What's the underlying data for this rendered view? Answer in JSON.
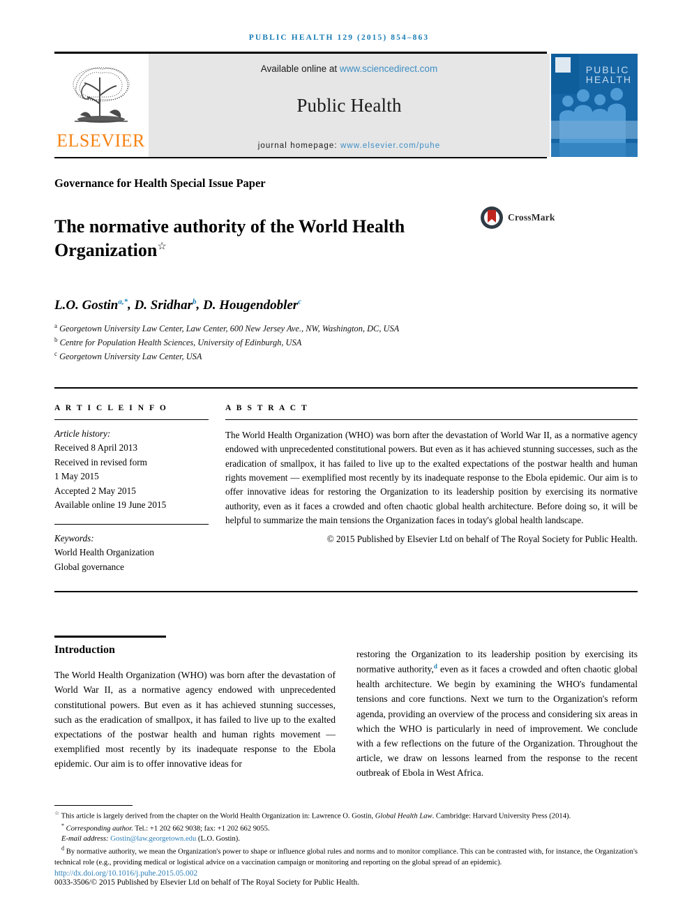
{
  "running_head": "PUBLIC HEALTH 129 (2015) 854–863",
  "masthead": {
    "publisher_logo_name": "ELSEVIER",
    "available_prefix": "Available online at ",
    "available_link": "www.sciencedirect.com",
    "journal_title": "Public Health",
    "homepage_prefix": "journal homepage: ",
    "homepage_link": "www.elsevier.com/puhe",
    "cover_title_line1": "PUBLIC",
    "cover_title_line2": "HEALTH",
    "link_color": "#3d8ec4",
    "elsevier_orange": "#f68212",
    "cover_blue": "#1565a5"
  },
  "article": {
    "section_label": "Governance for Health Special Issue Paper",
    "title": "The normative authority of the World Health Organization",
    "title_footnote_marker": "☆",
    "crossmark_label": "CrossMark",
    "authors": "L.O. Gostin ",
    "authors_parts": [
      {
        "name": "L.O. Gostin",
        "marks": "a,*"
      },
      {
        "name": "D. Sridhar",
        "marks": "b"
      },
      {
        "name": "D. Hougendobler",
        "marks": "c"
      }
    ],
    "affiliations": [
      {
        "mark": "a",
        "text": "Georgetown University Law Center, Law Center, 600 New Jersey Ave., NW, Washington, DC, USA"
      },
      {
        "mark": "b",
        "text": "Centre for Population Health Sciences, University of Edinburgh, USA"
      },
      {
        "mark": "c",
        "text": "Georgetown University Law Center, USA"
      }
    ]
  },
  "info": {
    "heading": "A R T I C L E   I N F O",
    "history_label": "Article history:",
    "history": [
      "Received 8 April 2013",
      "Received in revised form",
      "1 May 2015",
      "Accepted 2 May 2015",
      "Available online 19 June 2015"
    ],
    "keywords_label": "Keywords:",
    "keywords": [
      "World Health Organization",
      "Global governance"
    ]
  },
  "abstract": {
    "heading": "A B S T R A C T",
    "text": "The World Health Organization (WHO) was born after the devastation of World War II, as a normative agency endowed with unprecedented constitutional powers. But even as it has achieved stunning successes, such as the eradication of smallpox, it has failed to live up to the exalted expectations of the postwar health and human rights movement — exemplified most recently by its inadequate response to the Ebola epidemic. Our aim is to offer innovative ideas for restoring the Organization to its leadership position by exercising its normative authority, even as it faces a crowded and often chaotic global health architecture. Before doing so, it will be helpful to summarize the main tensions the Organization faces in today's global health landscape.",
    "copyright": "© 2015  Published by Elsevier Ltd on behalf of The Royal Society for Public Health."
  },
  "body": {
    "heading": "Introduction",
    "left_paragraph": "The World Health Organization (WHO) was born after the devastation of World War II, as a normative agency endowed with unprecedented constitutional powers. But even as it has achieved stunning successes, such as the eradication of smallpox, it has failed to live up to the exalted expectations of the postwar health and human rights movement — exemplified most recently by its inadequate response to the Ebola epidemic. Our aim is to offer innovative ideas for",
    "right_paragraph_1": "restoring the Organization to its leadership position by exercising its normative authority,",
    "right_footnote_marker": "d",
    "right_paragraph_2": " even as it faces a crowded and often chaotic global health architecture. We begin by examining the WHO's fundamental tensions and core functions. Next we turn to the Organization's reform agenda, providing an overview of the process and considering six areas in which the WHO is particularly in need of improvement. We conclude with a few reflections on the future of the Organization. Throughout the article, we draw on lessons learned from the response to the recent outbreak of Ebola in West Africa."
  },
  "footnotes": {
    "star_marker": "☆",
    "star_text_pre": " This article is largely derived from the chapter on the World Health Organization in: Lawrence O. Gostin, ",
    "star_text_italic": "Global Health Law",
    "star_text_post": ". Cambridge: Harvard University Press (2014).",
    "corr_marker": "*",
    "corr_label": "Corresponding author.",
    "corr_text": " Tel.: +1 202 662 9038; fax: +1 202 662 9055.",
    "email_label": "E-mail address: ",
    "email": "Gostin@law.georgetown.edu",
    "email_owner": " (L.O. Gostin).",
    "d_marker": "d",
    "d_text": " By normative authority, we mean the Organization's power to shape or influence global rules and norms and to monitor compliance. This can be contrasted with, for instance, the Organization's technical role (e.g., providing medical or logistical advice on a vaccination campaign or monitoring and reporting on the global spread of an epidemic).",
    "doi": "http://dx.doi.org/10.1016/j.puhe.2015.05.002",
    "issn_line": "0033-3506/© 2015  Published by Elsevier Ltd on behalf of The Royal Society for Public Health."
  }
}
